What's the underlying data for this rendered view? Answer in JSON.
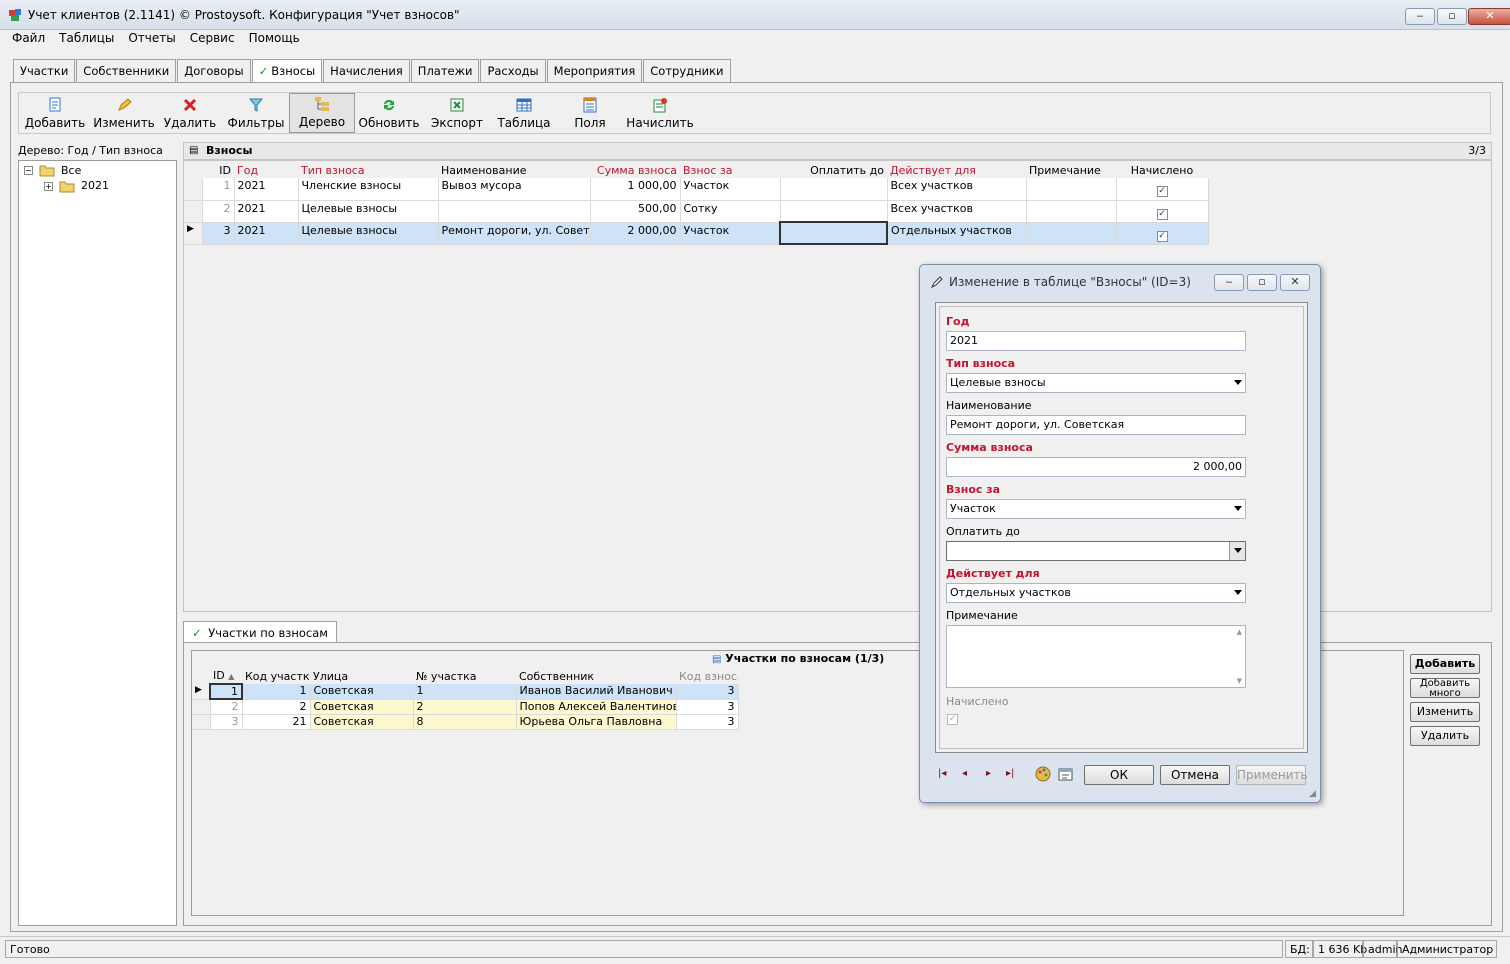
{
  "window": {
    "title": "Учет клиентов (2.1141) © Prostoysoft. Конфигурация \"Учет взносов\"",
    "min_label": "‒",
    "max_label": "▫",
    "close_label": "✕"
  },
  "menu": [
    "Файл",
    "Таблицы",
    "Отчеты",
    "Сервис",
    "Помощь"
  ],
  "tabs": [
    {
      "label": "Участки"
    },
    {
      "label": "Собственники"
    },
    {
      "label": "Договоры"
    },
    {
      "label": "Взносы",
      "active": true
    },
    {
      "label": "Начисления"
    },
    {
      "label": "Платежи"
    },
    {
      "label": "Расходы"
    },
    {
      "label": "Мероприятия"
    },
    {
      "label": "Сотрудники"
    }
  ],
  "toolbar": [
    {
      "label": "Добавить",
      "icon": "add-doc-icon",
      "color": "#2e7bd6"
    },
    {
      "label": "Изменить",
      "icon": "pencil-icon",
      "color": "#e0a020"
    },
    {
      "label": "Удалить",
      "icon": "delete-x-icon",
      "color": "#d62020"
    },
    {
      "label": "Фильтры",
      "icon": "filter-icon",
      "color": "#3aa0d0"
    },
    {
      "label": "Дерево",
      "icon": "tree-icon",
      "color": "#d6a21e"
    },
    {
      "label": "Обновить",
      "icon": "refresh-icon",
      "color": "#27a13a"
    },
    {
      "label": "Экспорт",
      "icon": "excel-icon",
      "color": "#1f8a3a"
    },
    {
      "label": "Таблица",
      "icon": "table-icon",
      "color": "#2f6fc2"
    },
    {
      "label": "Поля",
      "icon": "fields-icon",
      "color": "#2f6fc2"
    },
    {
      "label": "Начислить",
      "icon": "charge-icon",
      "color": "#c23a2a"
    }
  ],
  "tree": {
    "header": "Дерево: Год / Тип взноса",
    "root": "Все",
    "child": "2021"
  },
  "main_grid": {
    "title": "Взносы",
    "counter": "3/3",
    "columns": [
      "ID",
      "Год",
      "Тип взноса",
      "Наименование",
      "Сумма взноса",
      "Взнос за",
      "Оплатить до",
      "Действует для",
      "Примечание",
      "Начислено"
    ],
    "rows": [
      {
        "id": "1",
        "year": "2021",
        "type": "Членские взносы",
        "name": "Вывоз мусора",
        "sum": "1 000,00",
        "for": "Участок",
        "pay_until": "",
        "applies": "Всех участков",
        "note": "",
        "charged": "✓"
      },
      {
        "id": "2",
        "year": "2021",
        "type": "Целевые взносы",
        "name": "",
        "sum": "500,00",
        "for": "Сотку",
        "pay_until": "",
        "applies": "Всех участков",
        "note": "",
        "charged": "✓"
      },
      {
        "id": "3",
        "year": "2021",
        "type": "Целевые взносы",
        "name": "Ремонт дороги, ул. Советская",
        "sum": "2 000,00",
        "for": "Участок",
        "pay_until": "",
        "applies": "Отдельных участков",
        "note": "",
        "charged": "✓"
      }
    ]
  },
  "sub_tab": {
    "label": "Участки по взносам"
  },
  "sub_grid": {
    "title": "Участки по взносам (1/3)",
    "columns": [
      "ID",
      "Код участка",
      "Улица",
      "№ участка",
      "Собственник",
      "Код взноса"
    ],
    "rows": [
      {
        "id": "1",
        "code": "1",
        "street": "Советская",
        "num": "1",
        "owner": "Иванов Василий Иванович",
        "fee": "3"
      },
      {
        "id": "2",
        "code": "2",
        "street": "Советская",
        "num": "2",
        "owner": "Попов Алексей Валентинович",
        "fee": "3"
      },
      {
        "id": "3",
        "code": "21",
        "street": "Советская",
        "num": "8",
        "owner": "Юрьева Ольга Павловна",
        "fee": "3"
      }
    ],
    "buttons": [
      "Добавить",
      "Добавить много",
      "Изменить",
      "Удалить"
    ]
  },
  "dialog": {
    "title": "Изменение в таблице \"Взносы\" (ID=3)",
    "fields": {
      "year": {
        "label": "Год",
        "value": "2021"
      },
      "type": {
        "label": "Тип взноса",
        "value": "Целевые взносы"
      },
      "name": {
        "label": "Наименование",
        "value": "Ремонт дороги, ул. Советская"
      },
      "sum": {
        "label": "Сумма взноса",
        "value": "2 000,00"
      },
      "for": {
        "label": "Взнос за",
        "value": "Участок"
      },
      "pay_until": {
        "label": "Оплатить до",
        "value": ""
      },
      "applies": {
        "label": "Действует для",
        "value": "Отдельных участков"
      },
      "note": {
        "label": "Примечание",
        "value": ""
      },
      "charged": {
        "label": "Начислено",
        "mark": "✓"
      }
    },
    "nav": {
      "first": "|◂",
      "prev": "◂",
      "next": "▸",
      "last": "▸|"
    },
    "ok": "ОК",
    "cancel": "Отмена",
    "apply": "Применить"
  },
  "status": {
    "text": "Готово",
    "db_label": "БД:",
    "db_size": "1 636 Kb",
    "user": "admin",
    "role": "Администратор"
  }
}
